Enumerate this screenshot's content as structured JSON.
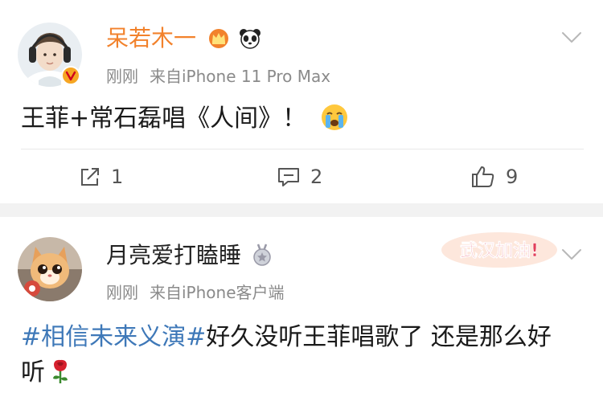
{
  "posts": [
    {
      "username": "呆若木一",
      "time": "刚刚",
      "source": "来自iPhone 11 Pro Max",
      "text": "王菲+常石磊唱《人间》！",
      "actions": {
        "share": "1",
        "comment": "2",
        "like": "9"
      }
    },
    {
      "username": "月亮爱打瞌睡",
      "time": "刚刚",
      "source": "来自iPhone客户端",
      "topic": "#相信未来义演#",
      "text": "好久没听王菲唱歌了 还是那么好听",
      "sticker": "武汉加油!"
    }
  ],
  "colors": {
    "vip_name": "#f2822c",
    "topic": "#3e78b8",
    "meta": "#8a8a8a",
    "sticker": "#e2405a"
  },
  "icons": [
    "crown-icon",
    "panda-icon",
    "crying-emoji-icon",
    "rose-emoji-icon",
    "medal-icon",
    "share-icon",
    "comment-icon",
    "like-icon",
    "chevron-down-icon",
    "verified-badge-icon"
  ]
}
